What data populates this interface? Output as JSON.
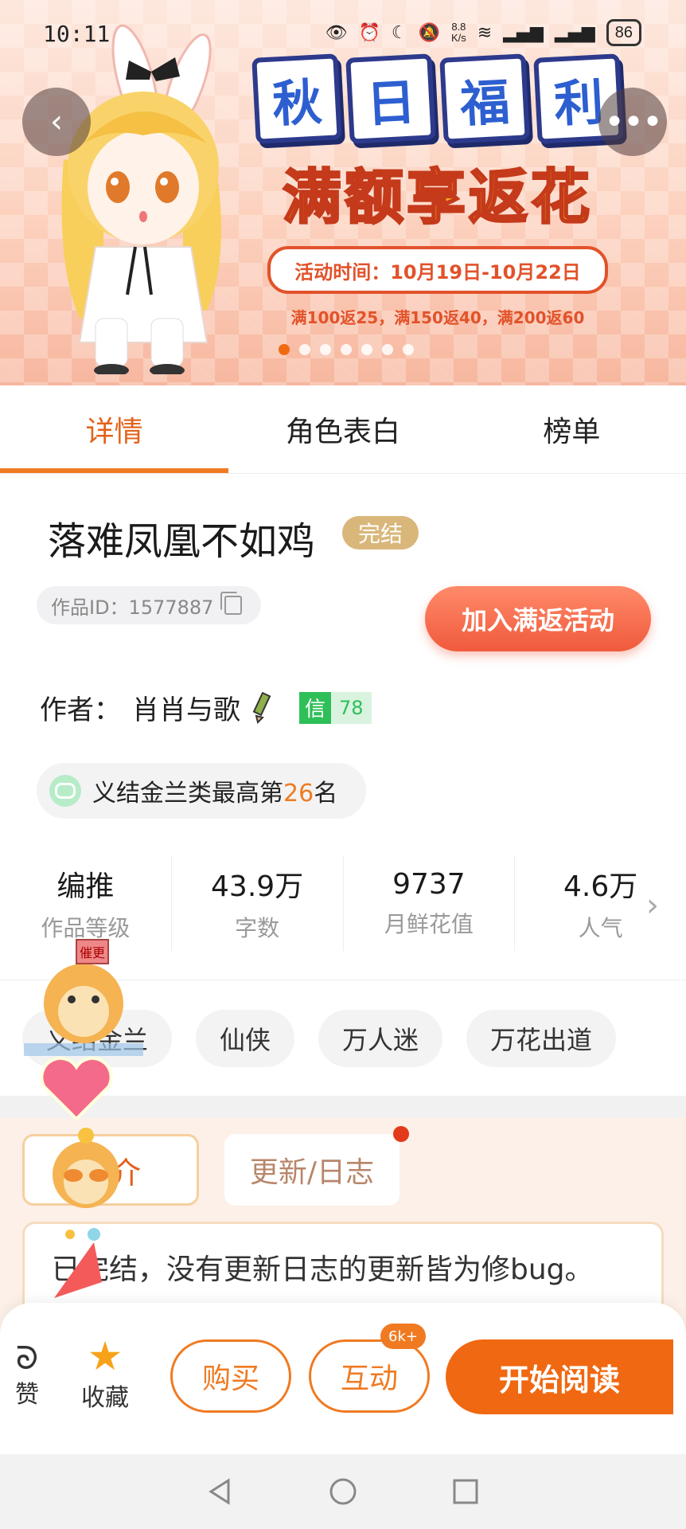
{
  "status_bar": {
    "time": "10:11",
    "speed_value": "8.8",
    "speed_unit": "K/s",
    "battery": "86"
  },
  "banner": {
    "title_chars": [
      "秋",
      "日",
      "福",
      "利"
    ],
    "subtitle": "满额享返花",
    "event_time": "活动时间：10月19日-10月22日",
    "rebate": "满100返25，满150返40，满200返60",
    "slide_count": 7,
    "active_slide": 0
  },
  "tabs": [
    {
      "label": "详情",
      "active": true
    },
    {
      "label": "角色表白",
      "active": false
    },
    {
      "label": "榜单",
      "active": false
    }
  ],
  "book": {
    "title": "落难凤凰不如鸡",
    "status": "完结",
    "id_label": "作品ID：1577887",
    "join_button": "加入满返活动",
    "author_label": "作者：",
    "author_name": "肖肖与歌",
    "trust_tag": "信",
    "trust_value": "78",
    "rank_prefix": "义结金兰类最高第",
    "rank_number": "26",
    "rank_suffix": "名"
  },
  "stats": [
    {
      "value": "编推",
      "label": "作品等级"
    },
    {
      "value": "43.9万",
      "label": "字数"
    },
    {
      "value": "9737",
      "label": "月鲜花值"
    },
    {
      "value": "4.6万",
      "label": "人气"
    }
  ],
  "tags": [
    "义结金兰",
    "仙侠",
    "万人迷",
    "万花出道"
  ],
  "intro": {
    "tab_intro": "简介",
    "tab_log": "更新/日志",
    "text": "已完结，没有更新日志的更新皆为修bug。"
  },
  "bottom": {
    "like_label": "赞",
    "fav_label": "收藏",
    "buy_label": "购买",
    "interact_label": "互动",
    "interact_badge": "6k+",
    "read_label": "开始阅读"
  },
  "colors": {
    "accent": "#f06812",
    "trust_green": "#2fbf58",
    "badge_gold": "#d9b77a"
  }
}
